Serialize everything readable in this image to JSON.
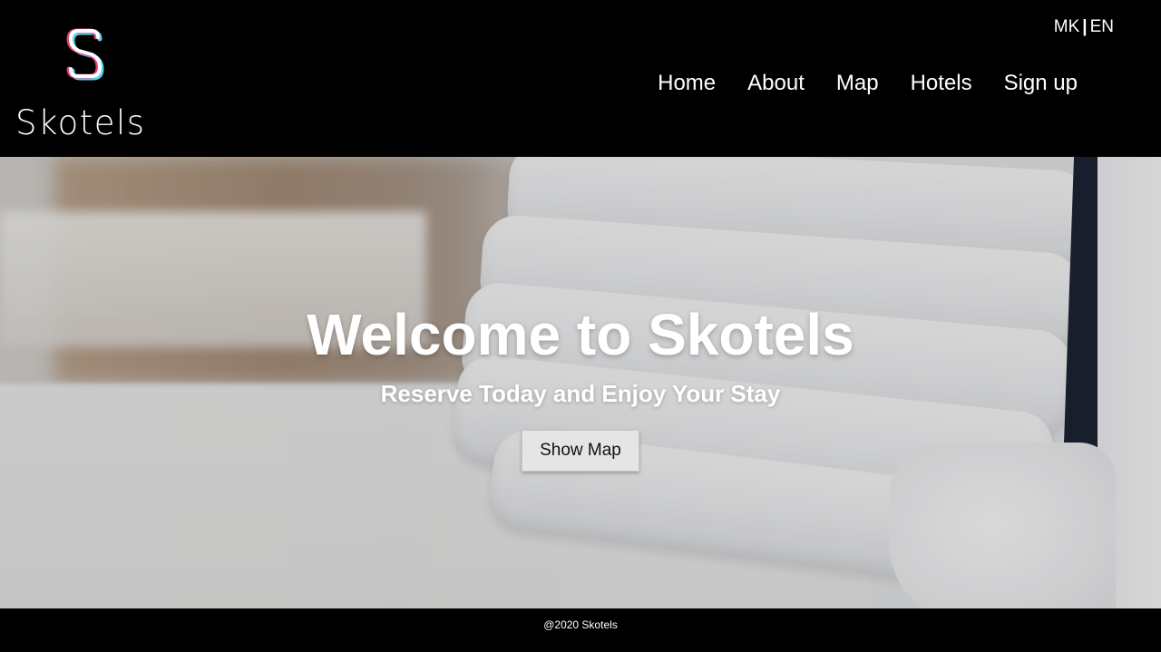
{
  "brand": {
    "logo_letter": "S",
    "name": "Skotels",
    "logo_colors": {
      "primary": "#ffffff",
      "accent_pink": "#e0457b",
      "accent_cyan": "#5bd1e6"
    }
  },
  "language_switcher": {
    "options": [
      "MK",
      "EN"
    ],
    "separator": "|"
  },
  "nav": {
    "items": [
      {
        "label": "Home"
      },
      {
        "label": "About"
      },
      {
        "label": "Map"
      },
      {
        "label": "Hotels"
      },
      {
        "label": "Sign up"
      }
    ]
  },
  "hero": {
    "title": "Welcome to Skotels",
    "subtitle": "Reserve Today and Enjoy Your Stay",
    "button_label": "Show Map"
  },
  "footer": {
    "text": "@2020 Skotels"
  },
  "colors": {
    "header_bg": "#000000",
    "footer_bg": "#000000",
    "text_light": "#ffffff",
    "button_bg": "#e5e5e5"
  }
}
